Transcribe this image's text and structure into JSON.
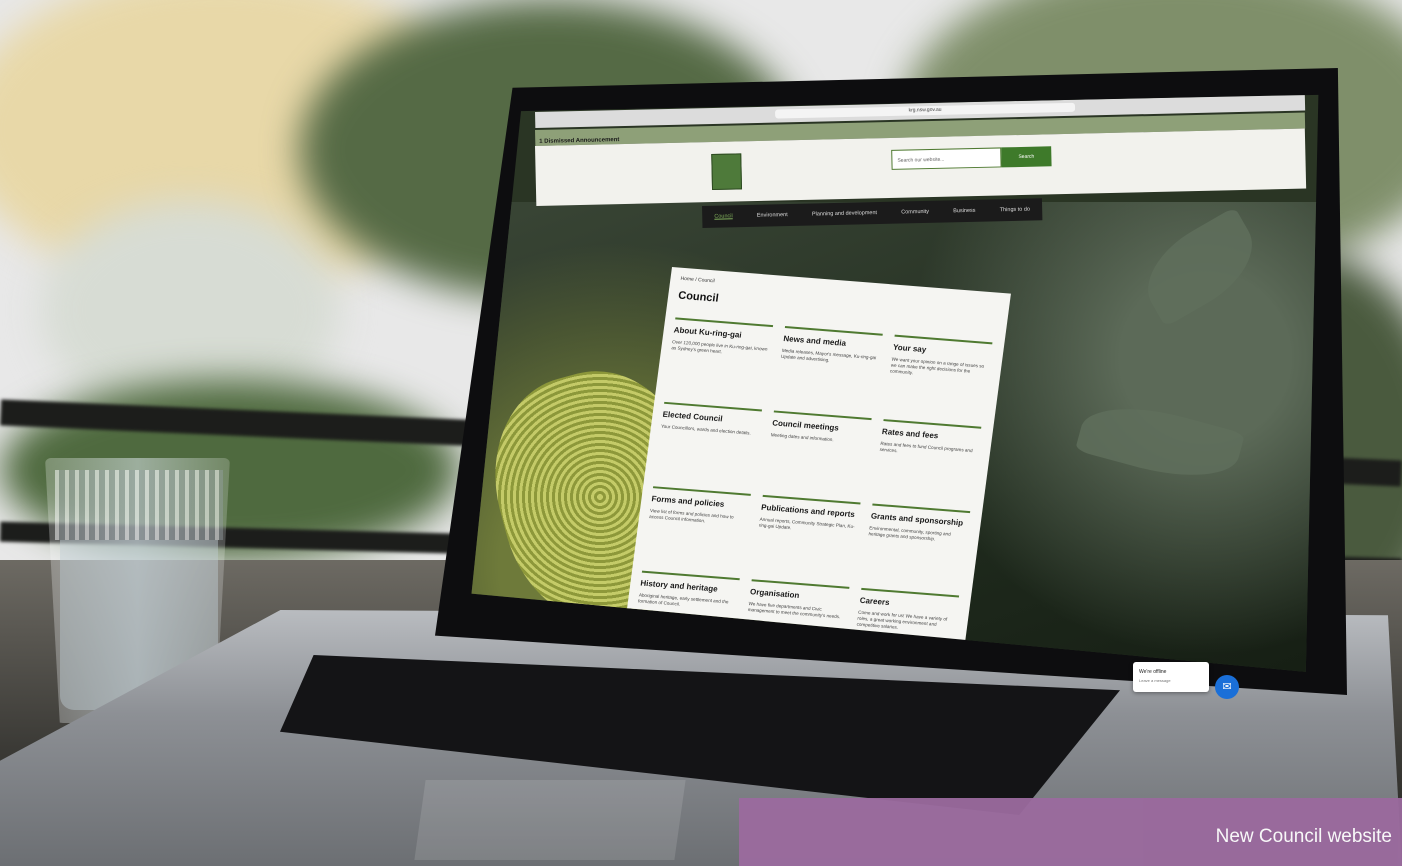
{
  "browser": {
    "url": "krg.nsw.gov.au"
  },
  "announcement": {
    "text": "1 Dismissed Announcement"
  },
  "search": {
    "placeholder": "Search our website...",
    "button": "Search"
  },
  "nav": [
    "Council",
    "Environment",
    "Planning and development",
    "Community",
    "Business",
    "Things to do"
  ],
  "breadcrumb": "Home  /  Council",
  "page_title": "Council",
  "tiles": [
    {
      "title": "About Ku-ring-gai",
      "desc": "Over 120,000 people live in Ku-ring-gai, known as Sydney's green heart."
    },
    {
      "title": "News and media",
      "desc": "Media releases, Mayor's message, Ku-ring-gai Update and advertising."
    },
    {
      "title": "Your say",
      "desc": "We want your opinion on a range of issues so we can make the right decisions for the community."
    },
    {
      "title": "Elected Council",
      "desc": "Your Councillors, wards and election details."
    },
    {
      "title": "Council meetings",
      "desc": "Meeting dates and information."
    },
    {
      "title": "Rates and fees",
      "desc": "Rates and fees to fund Council programs and services."
    },
    {
      "title": "Forms and policies",
      "desc": "View list of forms and policies and how to access Council information."
    },
    {
      "title": "Publications and reports",
      "desc": "Annual reports, Community Strategic Plan, Ku-ring-gai Update."
    },
    {
      "title": "Grants and sponsorship",
      "desc": "Environmental, community, sporting and heritage grants and sponsorship."
    },
    {
      "title": "History and heritage",
      "desc": "Aboriginal heritage, early settlement and the formation of Council."
    },
    {
      "title": "Organisation",
      "desc": "We have five departments and Civic management to meet the community's needs."
    },
    {
      "title": "Careers",
      "desc": "Come and work for us! We have a variety of roles, a great working environment and competitive salaries."
    }
  ],
  "chat": {
    "status": "We're offline",
    "sub": "Leave a message"
  },
  "caption": "New Council website"
}
